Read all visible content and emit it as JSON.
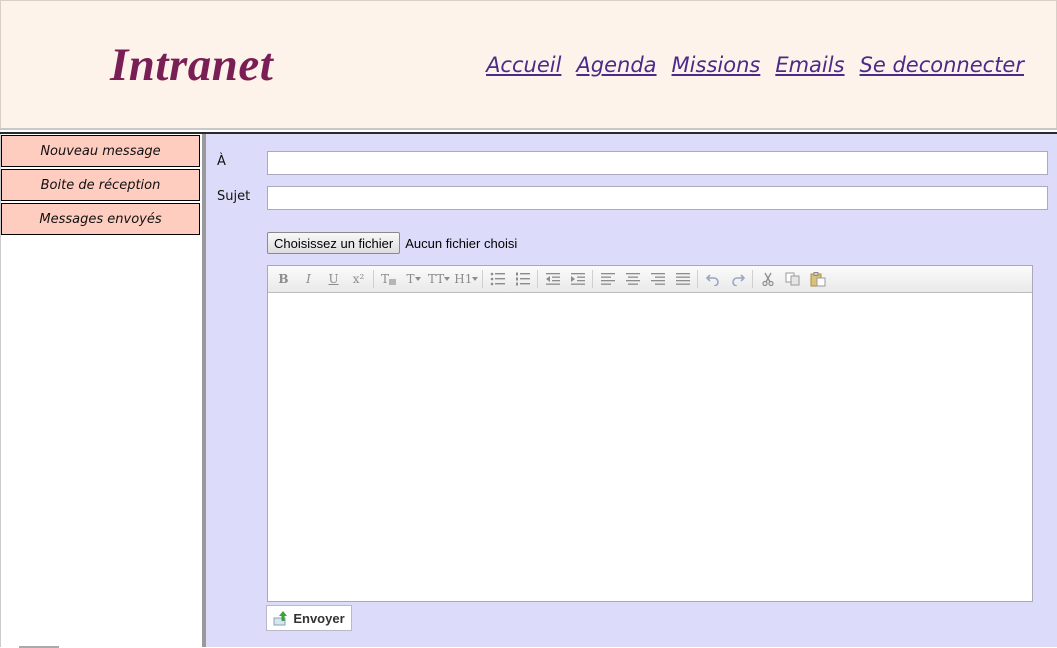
{
  "header": {
    "logo": "Intranet",
    "nav": [
      "Accueil",
      "Agenda",
      "Missions",
      "Emails",
      "Se deconnecter"
    ]
  },
  "sidebar": {
    "items": [
      {
        "label": "Nouveau message"
      },
      {
        "label": "Boite de réception"
      },
      {
        "label": "Messages envoyés"
      }
    ]
  },
  "compose": {
    "to_label": "À",
    "to_value": "",
    "subject_label": "Sujet",
    "subject_value": "",
    "file_button": "Choisissez un fichier",
    "file_status": "Aucun fichier choisi",
    "toolbar": {
      "bold": "B",
      "italic": "I",
      "underline": "U",
      "superscript": "x²",
      "font": "T",
      "font_size": "TT",
      "heading": "H1"
    },
    "send_label": "Envoyer"
  },
  "colors": {
    "header_bg": "#fef3eb",
    "logo": "#7a1f55",
    "nav_link": "#4b2a8a",
    "sidebar_button": "#ffccc0",
    "main_bg": "#dcdcfa"
  }
}
